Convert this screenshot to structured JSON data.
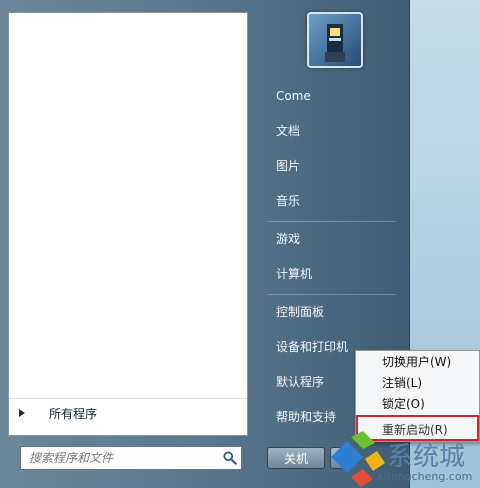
{
  "left_pane": {
    "all_programs": "所有程序",
    "search_placeholder": "搜索程序和文件"
  },
  "right_pane": {
    "items": [
      {
        "label": "Come"
      },
      {
        "label": "文档"
      },
      {
        "label": "图片"
      },
      {
        "label": "音乐"
      },
      {
        "label": "游戏"
      },
      {
        "label": "计算机"
      },
      {
        "label": "控制面板"
      },
      {
        "label": "设备和打印机"
      },
      {
        "label": "默认程序"
      },
      {
        "label": "帮助和支持"
      }
    ]
  },
  "shutdown": {
    "label": "关机"
  },
  "power_menu": {
    "items": [
      {
        "label": "切换用户(W)"
      },
      {
        "label": "注销(L)"
      },
      {
        "label": "锁定(O)"
      },
      {
        "label": "重新启动(R)"
      }
    ]
  },
  "watermark": {
    "text": "系统城",
    "url": "xitongcheng.com"
  },
  "colors": {
    "menu_blue": "#5b7a8f",
    "highlight_red": "#d4262d"
  }
}
